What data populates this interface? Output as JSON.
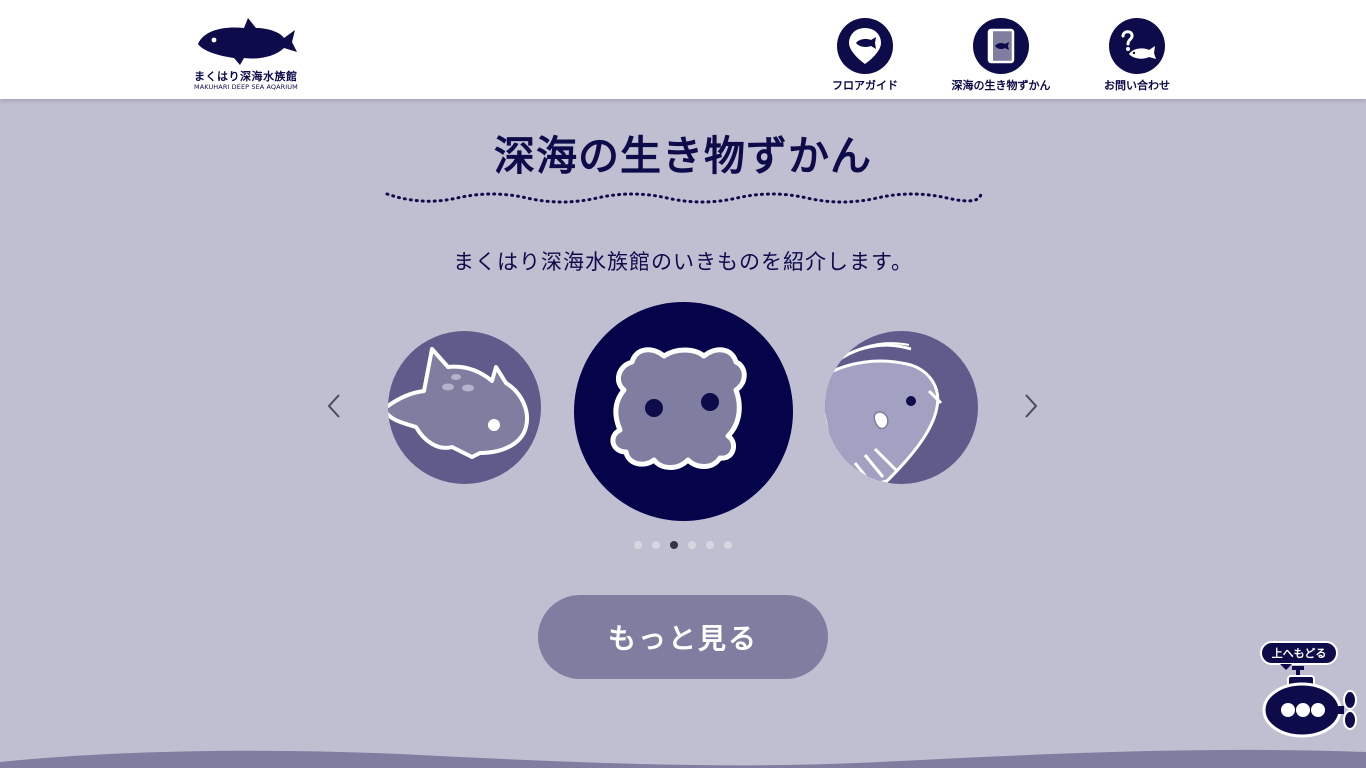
{
  "header": {
    "logo": {
      "name_ja": "まくはり深海水族館",
      "name_en": "MAKUHARI DEEP SEA AQARIUM",
      "icon": "coelacanth-icon"
    },
    "nav": [
      {
        "label": "フロアガイド",
        "icon": "map-pin-fish-icon"
      },
      {
        "label": "深海の生き物ずかん",
        "icon": "picture-book-icon"
      },
      {
        "label": "お問い合わせ",
        "icon": "question-fish-icon"
      }
    ]
  },
  "main": {
    "title": "深海の生き物ずかん",
    "lead": "まくはり深海水族館のいきものを紹介します。",
    "carousel": {
      "slides": [
        {
          "icon": "coelacanth-icon",
          "state": "prev"
        },
        {
          "icon": "dumbo-octopus-icon",
          "state": "current"
        },
        {
          "icon": "anglerfish-icon",
          "state": "next"
        }
      ],
      "prev_icon": "chevron-left-icon",
      "next_icon": "chevron-right-icon",
      "page_count": 6,
      "active_page": 3
    },
    "more_button": "もっと見る"
  },
  "back_to_top": {
    "label": "上へもどる",
    "icon": "submarine-icon"
  },
  "colors": {
    "navy": "#0d0b4a",
    "background": "#c0bfd2",
    "button": "#7f7ea1",
    "slide_side": "#5f5b8b"
  }
}
